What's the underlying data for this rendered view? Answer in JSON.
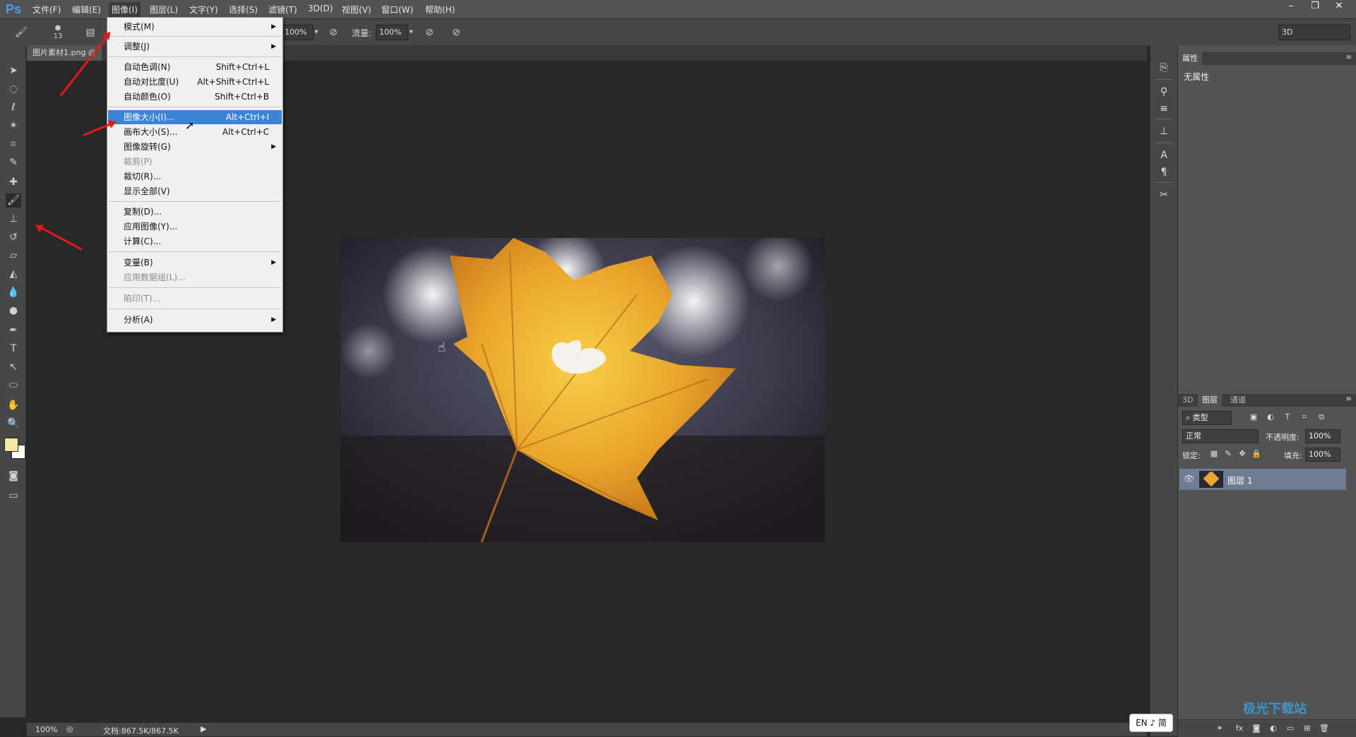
{
  "app": {
    "logo": "Ps"
  },
  "menubar": {
    "items": [
      "文件(F)",
      "编辑(E)",
      "图像(I)",
      "图层(L)",
      "文字(Y)",
      "选择(S)",
      "滤镜(T)",
      "3D(D)",
      "视图(V)",
      "窗口(W)",
      "帮助(H)"
    ],
    "active_index": 2
  },
  "window_buttons": {
    "minimize": "–",
    "restore": "❐",
    "close": "✕"
  },
  "options": {
    "brush_size": "13",
    "opacity_value": "100%",
    "flow_label": "流量:",
    "flow_value": "100%",
    "workspace": "3D"
  },
  "document": {
    "tab_title": "图片素材1.png @"
  },
  "status": {
    "zoom": "100%",
    "doc_info": "文档:867.5K/867.5K"
  },
  "image_menu": {
    "items": [
      {
        "label": "模式(M)",
        "shortcut": "",
        "submenu": true,
        "disabled": false
      },
      {
        "label": "调整(J)",
        "shortcut": "",
        "submenu": true,
        "disabled": false
      },
      {
        "label": "自动色调(N)",
        "shortcut": "Shift+Ctrl+L",
        "submenu": false,
        "disabled": false
      },
      {
        "label": "自动对比度(U)",
        "shortcut": "Alt+Shift+Ctrl+L",
        "submenu": false,
        "disabled": false
      },
      {
        "label": "自动颜色(O)",
        "shortcut": "Shift+Ctrl+B",
        "submenu": false,
        "disabled": false
      },
      {
        "label": "图像大小(I)...",
        "shortcut": "Alt+Ctrl+I",
        "submenu": false,
        "disabled": false,
        "highlighted": true
      },
      {
        "label": "画布大小(S)...",
        "shortcut": "Alt+Ctrl+C",
        "submenu": false,
        "disabled": false
      },
      {
        "label": "图像旋转(G)",
        "shortcut": "",
        "submenu": true,
        "disabled": false
      },
      {
        "label": "裁剪(P)",
        "shortcut": "",
        "submenu": false,
        "disabled": true
      },
      {
        "label": "裁切(R)...",
        "shortcut": "",
        "submenu": false,
        "disabled": false
      },
      {
        "label": "显示全部(V)",
        "shortcut": "",
        "submenu": false,
        "disabled": false
      },
      {
        "label": "复制(D)...",
        "shortcut": "",
        "submenu": false,
        "disabled": false
      },
      {
        "label": "应用图像(Y)...",
        "shortcut": "",
        "submenu": false,
        "disabled": false
      },
      {
        "label": "计算(C)...",
        "shortcut": "",
        "submenu": false,
        "disabled": false
      },
      {
        "label": "变量(B)",
        "shortcut": "",
        "submenu": true,
        "disabled": false
      },
      {
        "label": "应用数据组(L)...",
        "shortcut": "",
        "submenu": false,
        "disabled": true
      },
      {
        "label": "陷印(T)...",
        "shortcut": "",
        "submenu": false,
        "disabled": true
      },
      {
        "label": "分析(A)",
        "shortcut": "",
        "submenu": true,
        "disabled": false
      }
    ]
  },
  "properties_panel": {
    "tab": "属性",
    "content": "无属性"
  },
  "layers_panel": {
    "tabs": [
      "3D",
      "图层",
      "通道"
    ],
    "active_tab": 1,
    "filter_kind": "类型",
    "blend_mode": "正常",
    "opacity_label": "不透明度:",
    "opacity_value": "100%",
    "lock_label": "锁定:",
    "fill_label": "填充:",
    "fill_value": "100%",
    "layers": [
      {
        "name": "图层 1",
        "visible": true
      }
    ]
  },
  "ime": {
    "text": "EN ♪ 简"
  },
  "watermark": {
    "text": "极光下载站"
  },
  "colors": {
    "foreground": "#f5e7a0",
    "background": "#ffffff",
    "highlight": "#3b84d6",
    "annotation": "#e31a1a"
  }
}
